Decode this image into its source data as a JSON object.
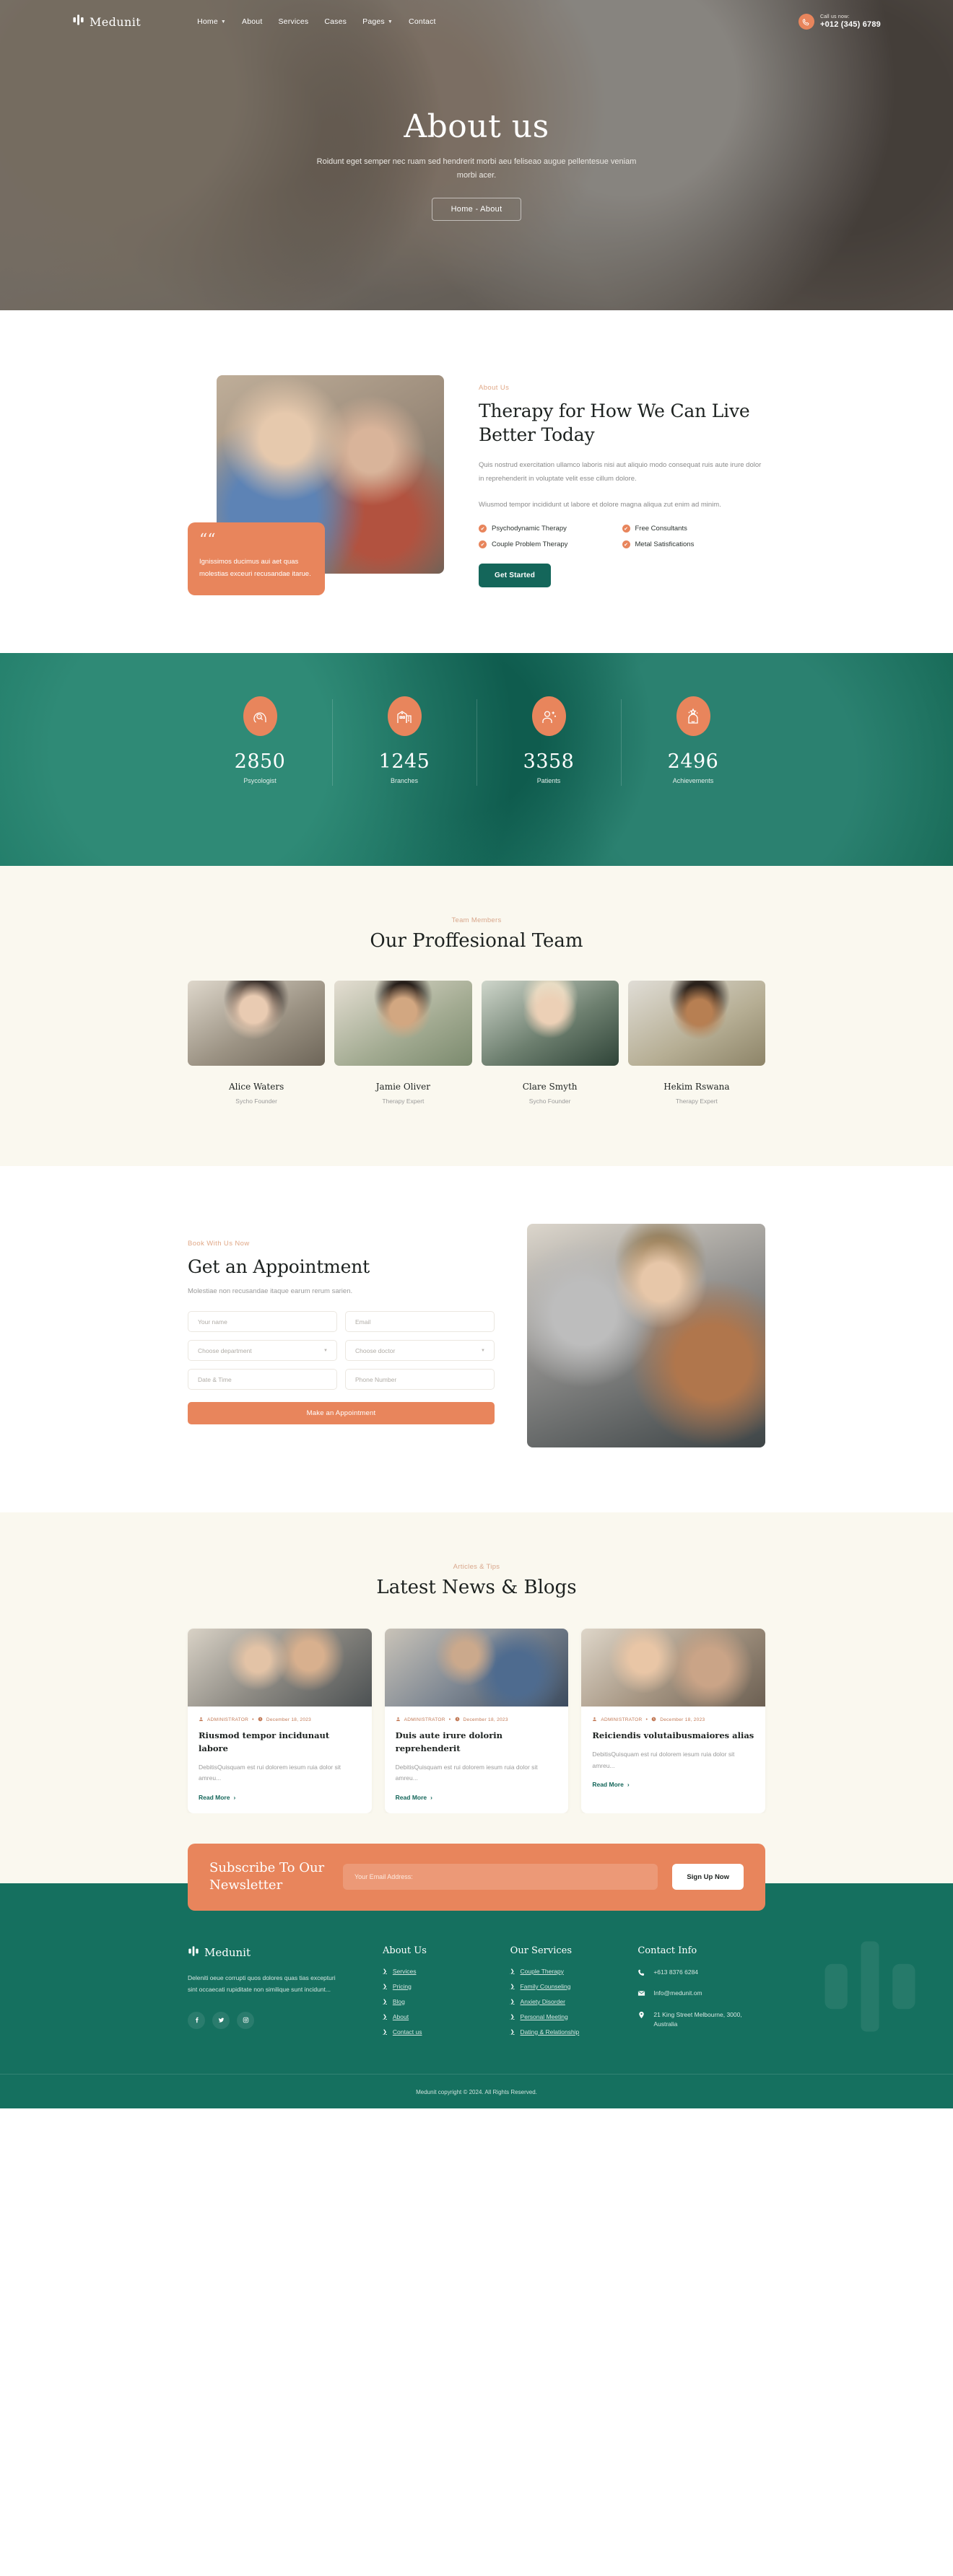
{
  "brand": {
    "name": "Medunit",
    "logo_icon": "medical-cross-icon"
  },
  "nav": {
    "items": [
      {
        "label": "Home",
        "has_caret": true
      },
      {
        "label": "About",
        "has_caret": false
      },
      {
        "label": "Services",
        "has_caret": false
      },
      {
        "label": "Cases",
        "has_caret": false
      },
      {
        "label": "Pages",
        "has_caret": true
      },
      {
        "label": "Contact",
        "has_caret": false
      }
    ],
    "call": {
      "icon": "phone-icon",
      "label": "Call us now:",
      "phone": "+012 (345) 6789"
    }
  },
  "hero": {
    "title": "About us",
    "subtitle": "Roidunt eget semper nec ruam sed hendrerit morbi aeu feliseao augue pellentesue veniam morbi acer.",
    "breadcrumb": "Home - About"
  },
  "about": {
    "eyebrow": "About Us",
    "title": "Therapy for How We Can Live Better Today",
    "paragraph1": "Quis nostrud exercitation ullamco laboris nisi aut aliquio modo consequat ruis aute irure dolor in reprehenderit in voluptate velit esse cillum dolore.",
    "paragraph2": "Wiusmod tempor incididunt ut labore et dolore magna aliqua zut enim ad minim.",
    "features": [
      "Psychodynamic Therapy",
      "Free Consultants",
      "Couple Problem Therapy",
      "Metal Satisfications"
    ],
    "cta": "Get Started",
    "quote": "Ignissimos ducimus aui aet quas molestias exceuri recusandae itarue."
  },
  "counters": [
    {
      "number": "2850",
      "label": "Psycologist",
      "icon": "head-search-icon"
    },
    {
      "number": "1245",
      "label": "Branches",
      "icon": "hospital-icon"
    },
    {
      "number": "3358",
      "label": "Patients",
      "icon": "patient-icon"
    },
    {
      "number": "2496",
      "label": "Achievements",
      "icon": "award-mind-icon"
    }
  ],
  "team": {
    "eyebrow": "Team Members",
    "title": "Our Proffesional Team",
    "members": [
      {
        "name": "Alice Waters",
        "role": "Sycho Founder"
      },
      {
        "name": "Jamie Oliver",
        "role": "Therapy Expert"
      },
      {
        "name": "Clare Smyth",
        "role": "Sycho Founder"
      },
      {
        "name": "Hekim Rswana",
        "role": "Therapy Expert"
      }
    ]
  },
  "appointment": {
    "eyebrow": "Book With Us Now",
    "title": "Get an Appointment",
    "subtitle": "Molestiae non recusandae itaque earum rerum sarien.",
    "fields": [
      {
        "name": "your-name",
        "placeholder": "Your name",
        "type": "text"
      },
      {
        "name": "email",
        "placeholder": "Email",
        "type": "text"
      },
      {
        "name": "choose-department",
        "placeholder": "Choose department",
        "type": "select"
      },
      {
        "name": "choose-doctor",
        "placeholder": "Choose doctor",
        "type": "select"
      },
      {
        "name": "date-time",
        "placeholder": "Date & Time",
        "type": "text"
      },
      {
        "name": "phone-number",
        "placeholder": "Phone Number",
        "type": "text"
      }
    ],
    "submit": "Make an Appointment"
  },
  "blog": {
    "eyebrow": "Articles & Tips",
    "title": "Latest News & Blogs",
    "posts": [
      {
        "author": "ADMINISTRATOR",
        "date": "December 18, 2023",
        "title": "Riusmod tempor incidunaut labore",
        "excerpt": "DebitisQuisquam est rui dolorem iesum ruia dolor sit amreu...",
        "more": "Read More"
      },
      {
        "author": "ADMINISTRATOR",
        "date": "December 18, 2023",
        "title": "Duis aute irure dolorin reprehenderit",
        "excerpt": "DebitisQuisquam est rui dolorem iesum ruia dolor sit amreu...",
        "more": "Read More"
      },
      {
        "author": "ADMINISTRATOR",
        "date": "December 18, 2023",
        "title": "Reiciendis volutaibusmaiores alias",
        "excerpt": "DebitisQuisquam est rui dolorem iesum ruia dolor sit amreu...",
        "more": "Read More"
      }
    ]
  },
  "newsletter": {
    "title": "Subscribe To Our Newsletter",
    "placeholder": "Your Email Address:",
    "button": "Sign Up Now"
  },
  "footer": {
    "description": "Deleniti oeue corrupti quos dolores quas tias excepturi sint occaecati rupiditate non similique sunt incidunt...",
    "social": [
      {
        "name": "facebook",
        "glyph": "f"
      },
      {
        "name": "twitter",
        "glyph": "t"
      },
      {
        "name": "instagram",
        "glyph": "i"
      }
    ],
    "col_about": {
      "heading": "About Us",
      "links": [
        "Services",
        "Pricing",
        "Blog",
        "About",
        "Contact us"
      ]
    },
    "col_services": {
      "heading": "Our Services",
      "links": [
        "Couple Therapy",
        "Family Counseling",
        "Anxiety Disorder",
        "Personal Meeting",
        "Dating & Relationship"
      ]
    },
    "col_contact": {
      "heading": "Contact Info",
      "phone": "+613 8376 6284",
      "email": "Info@medunit.om",
      "address": "21 King Street Melbourne, 3000, Australia"
    },
    "copyright": "Medunit copyright © 2024. All Rights Reserved."
  },
  "colors": {
    "accent_orange": "#e8855c",
    "brand_green": "#15705f",
    "cream": "#faf8ef",
    "eyebrow": "#d8a68b"
  }
}
